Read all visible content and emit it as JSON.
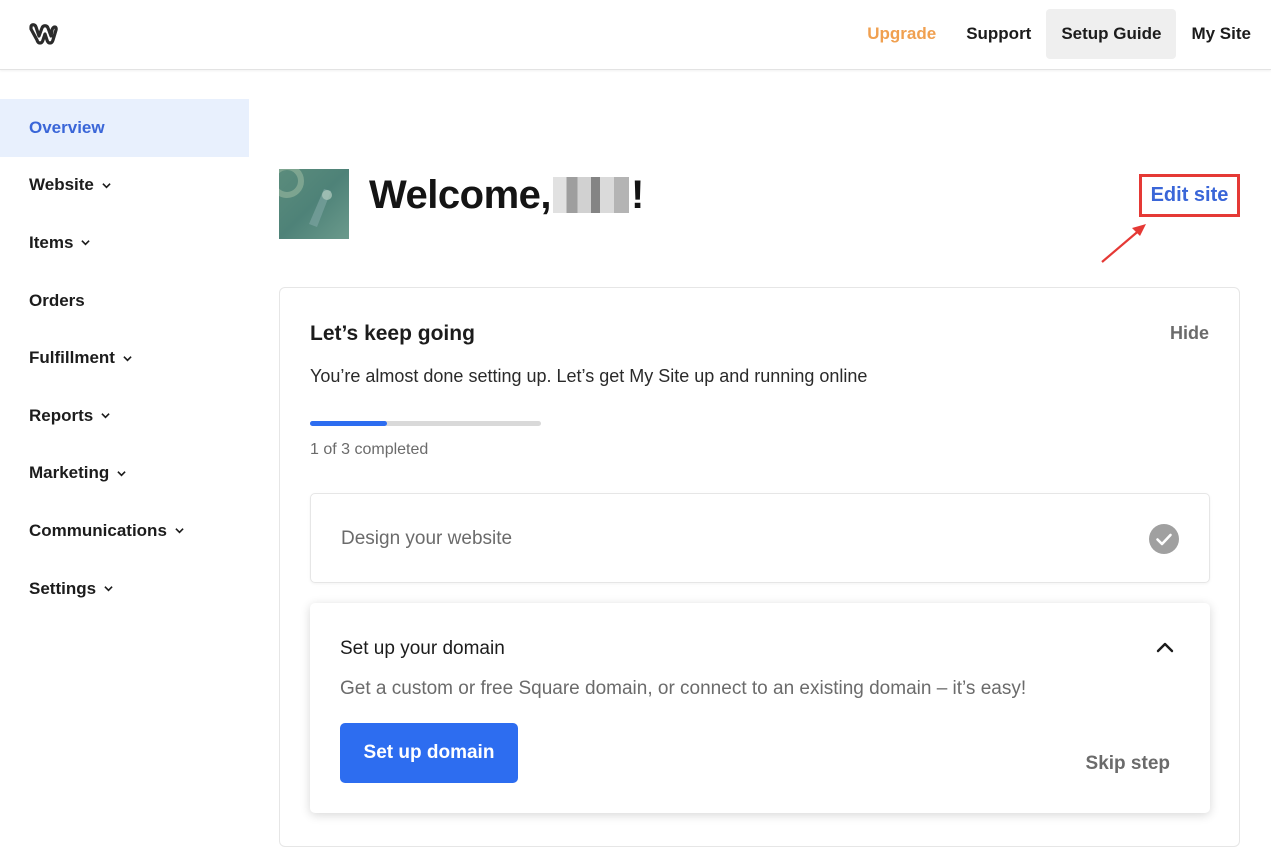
{
  "header": {
    "logo_icon": "weebly-w-icon",
    "nav": {
      "upgrade": "Upgrade",
      "support": "Support",
      "setup_guide": "Setup Guide",
      "my_site": "My Site"
    },
    "colors": {
      "upgrade": "#f0a050",
      "active_bg": "#efefef"
    }
  },
  "sidebar": {
    "items": [
      {
        "label": "Overview",
        "active": true,
        "has_chevron": false
      },
      {
        "label": "Website",
        "active": false,
        "has_chevron": true
      },
      {
        "label": "Items",
        "active": false,
        "has_chevron": true
      },
      {
        "label": "Orders",
        "active": false,
        "has_chevron": false
      },
      {
        "label": "Fulfillment",
        "active": false,
        "has_chevron": true
      },
      {
        "label": "Reports",
        "active": false,
        "has_chevron": true
      },
      {
        "label": "Marketing",
        "active": false,
        "has_chevron": true
      },
      {
        "label": "Communications",
        "active": false,
        "has_chevron": true
      },
      {
        "label": "Settings",
        "active": false,
        "has_chevron": true
      }
    ],
    "colors": {
      "active_bg": "#e8f0fd",
      "active_text": "#3a66d8"
    }
  },
  "welcome": {
    "prefix": "Welcome,",
    "suffix": "!",
    "edit_site": "Edit site"
  },
  "setup_card": {
    "title": "Let’s keep going",
    "hide": "Hide",
    "subtitle": "You’re almost done setting up. Let’s get My Site up and running online",
    "progress": {
      "completed": 1,
      "total": 3,
      "text": "1 of 3 completed"
    },
    "steps": [
      {
        "label": "Design your website",
        "done": true,
        "icon": "check-circle-icon"
      },
      {
        "label": "Set up your domain",
        "expanded": true,
        "description": "Get a custom or free Square domain, or connect to an existing domain – it’s easy!",
        "primary_button": "Set up domain",
        "skip": "Skip step",
        "icon": "chevron-up-icon"
      }
    ],
    "colors": {
      "primary": "#2d6df0",
      "annotation": "#e53935"
    }
  }
}
